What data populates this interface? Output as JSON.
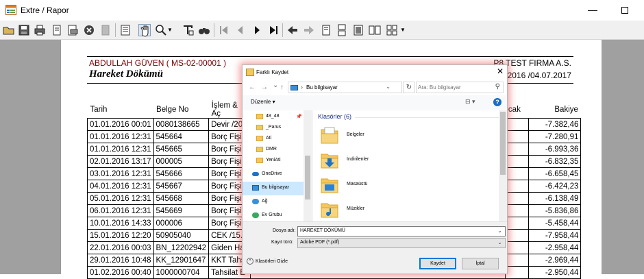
{
  "window": {
    "title": "Extre / Rapor",
    "minimize": "—",
    "icon": "report-app-icon"
  },
  "toolbar": {
    "icons": [
      "open-icon",
      "save-icon",
      "print-icon",
      "page-setup-icon",
      "export-icon",
      "stop-icon",
      "blank-page-icon",
      "document-map-icon",
      "hand-tool-icon",
      "zoom-icon",
      "text-icon",
      "find-icon",
      "first-page-icon",
      "previous-page-icon",
      "next-page-icon",
      "last-page-icon",
      "back-icon",
      "forward-icon",
      "single-page-icon",
      "continuous-page-icon",
      "facing-pages-icon",
      "two-pages-icon",
      "multi-page-icon"
    ]
  },
  "report": {
    "customer": "ABDULLAH GÜVEN ( MS-02-00001 )",
    "company": "P8 TEST FIRMA A.S.",
    "title": "Hareket Dökümü",
    "date_range_partial": "2016 /04.07.2017",
    "columns": {
      "date": "Tarih",
      "doc": "Belge No",
      "op": "İşlem & Aç",
      "credit_partial": "cak",
      "balance": "Bakiye"
    },
    "rows": [
      {
        "date": "01.01.2016 00:01",
        "doc": "0080138665",
        "op": "Devir /20",
        "balance": "-7.382,46"
      },
      {
        "date": "01.01.2016 12:31",
        "doc": "545664",
        "op": "Borç Fişi /",
        "balance": "-7.280,91"
      },
      {
        "date": "01.01.2016 12:31",
        "doc": "545665",
        "op": "Borç Fişi /",
        "balance": "-6.993,36"
      },
      {
        "date": "02.01.2016 13:17",
        "doc": "000005",
        "op": "Borç Fişi /",
        "balance": "-6.832,35"
      },
      {
        "date": "03.01.2016 12:31",
        "doc": "545666",
        "op": "Borç Fişi /",
        "balance": "-6.658,45"
      },
      {
        "date": "04.01.2016 12:31",
        "doc": "545667",
        "op": "Borç Fişi /",
        "balance": "-6.424,23"
      },
      {
        "date": "05.01.2016 12:31",
        "doc": "545668",
        "op": "Borç Fişi /",
        "balance": "-6.138,49"
      },
      {
        "date": "06.01.2016 12:31",
        "doc": "545669",
        "op": "Borç Fişi /",
        "balance": "-5.836,86"
      },
      {
        "date": "10.01.2016 14:33",
        "doc": "000006",
        "op": "Borç Fişi /",
        "balance": "-5.458,44"
      },
      {
        "date": "15.01.2016 12:20",
        "doc": "50905040",
        "op": "CEK /15.0",
        "balance": "-7.958,44"
      },
      {
        "date": "22.01.2016 00:03",
        "doc": "BN_12202942",
        "op": "Giden Hav",
        "balance": "-2.958,44"
      },
      {
        "date": "29.01.2016 10:48",
        "doc": "KK_12901647",
        "op": "KKT Tahs",
        "balance": "-2.969,44"
      },
      {
        "date": "01.02.2016 00:40",
        "doc": "1000000704",
        "op": "Tahsilat E",
        "balance": "-2.950,44"
      }
    ]
  },
  "dialog": {
    "title": "Farklı Kaydet",
    "close": "✕",
    "nav": {
      "back": "←",
      "forward": "→",
      "dropdown": "⌄",
      "up": "↑"
    },
    "address": "Bu bilgisayar",
    "address_sep": "›",
    "search_placeholder": "Ara: Bu bilgisayar",
    "organize": "Düzenle ▾",
    "view_icon": "⊟ ▾",
    "help": "?",
    "nav_items": [
      {
        "label": "48_48",
        "icon": "folder-icon"
      },
      {
        "label": "_Parus",
        "icon": "folder-icon"
      },
      {
        "label": "Ati",
        "icon": "folder-icon"
      },
      {
        "label": "DMR",
        "icon": "folder-icon"
      },
      {
        "label": "YeniAti",
        "icon": "folder-icon"
      },
      {
        "label": "OneDrive",
        "icon": "onedrive-icon"
      },
      {
        "label": "Bu bilgisayar",
        "icon": "computer-icon"
      },
      {
        "label": "Ağ",
        "icon": "network-icon"
      },
      {
        "label": "Ev Grubu",
        "icon": "homegroup-icon"
      }
    ],
    "group_title": "Klasörler (6)",
    "folders": [
      {
        "label": "Belgeler",
        "icon": "documents-folder-icon"
      },
      {
        "label": "İndirilenler",
        "icon": "downloads-folder-icon"
      },
      {
        "label": "Masaüstü",
        "icon": "desktop-folder-icon"
      },
      {
        "label": "Müzikler",
        "icon": "music-folder-icon"
      }
    ],
    "filename_label": "Dosya adı:",
    "filename_value": "HAREKET DÖKÜMÜ",
    "filetype_label": "Kayıt türü:",
    "filetype_value": "Adobe PDF (*.pdf)",
    "hide_folders": "Klasörleri Gizle",
    "save_button": "Kaydet",
    "cancel_button": "İptal"
  }
}
